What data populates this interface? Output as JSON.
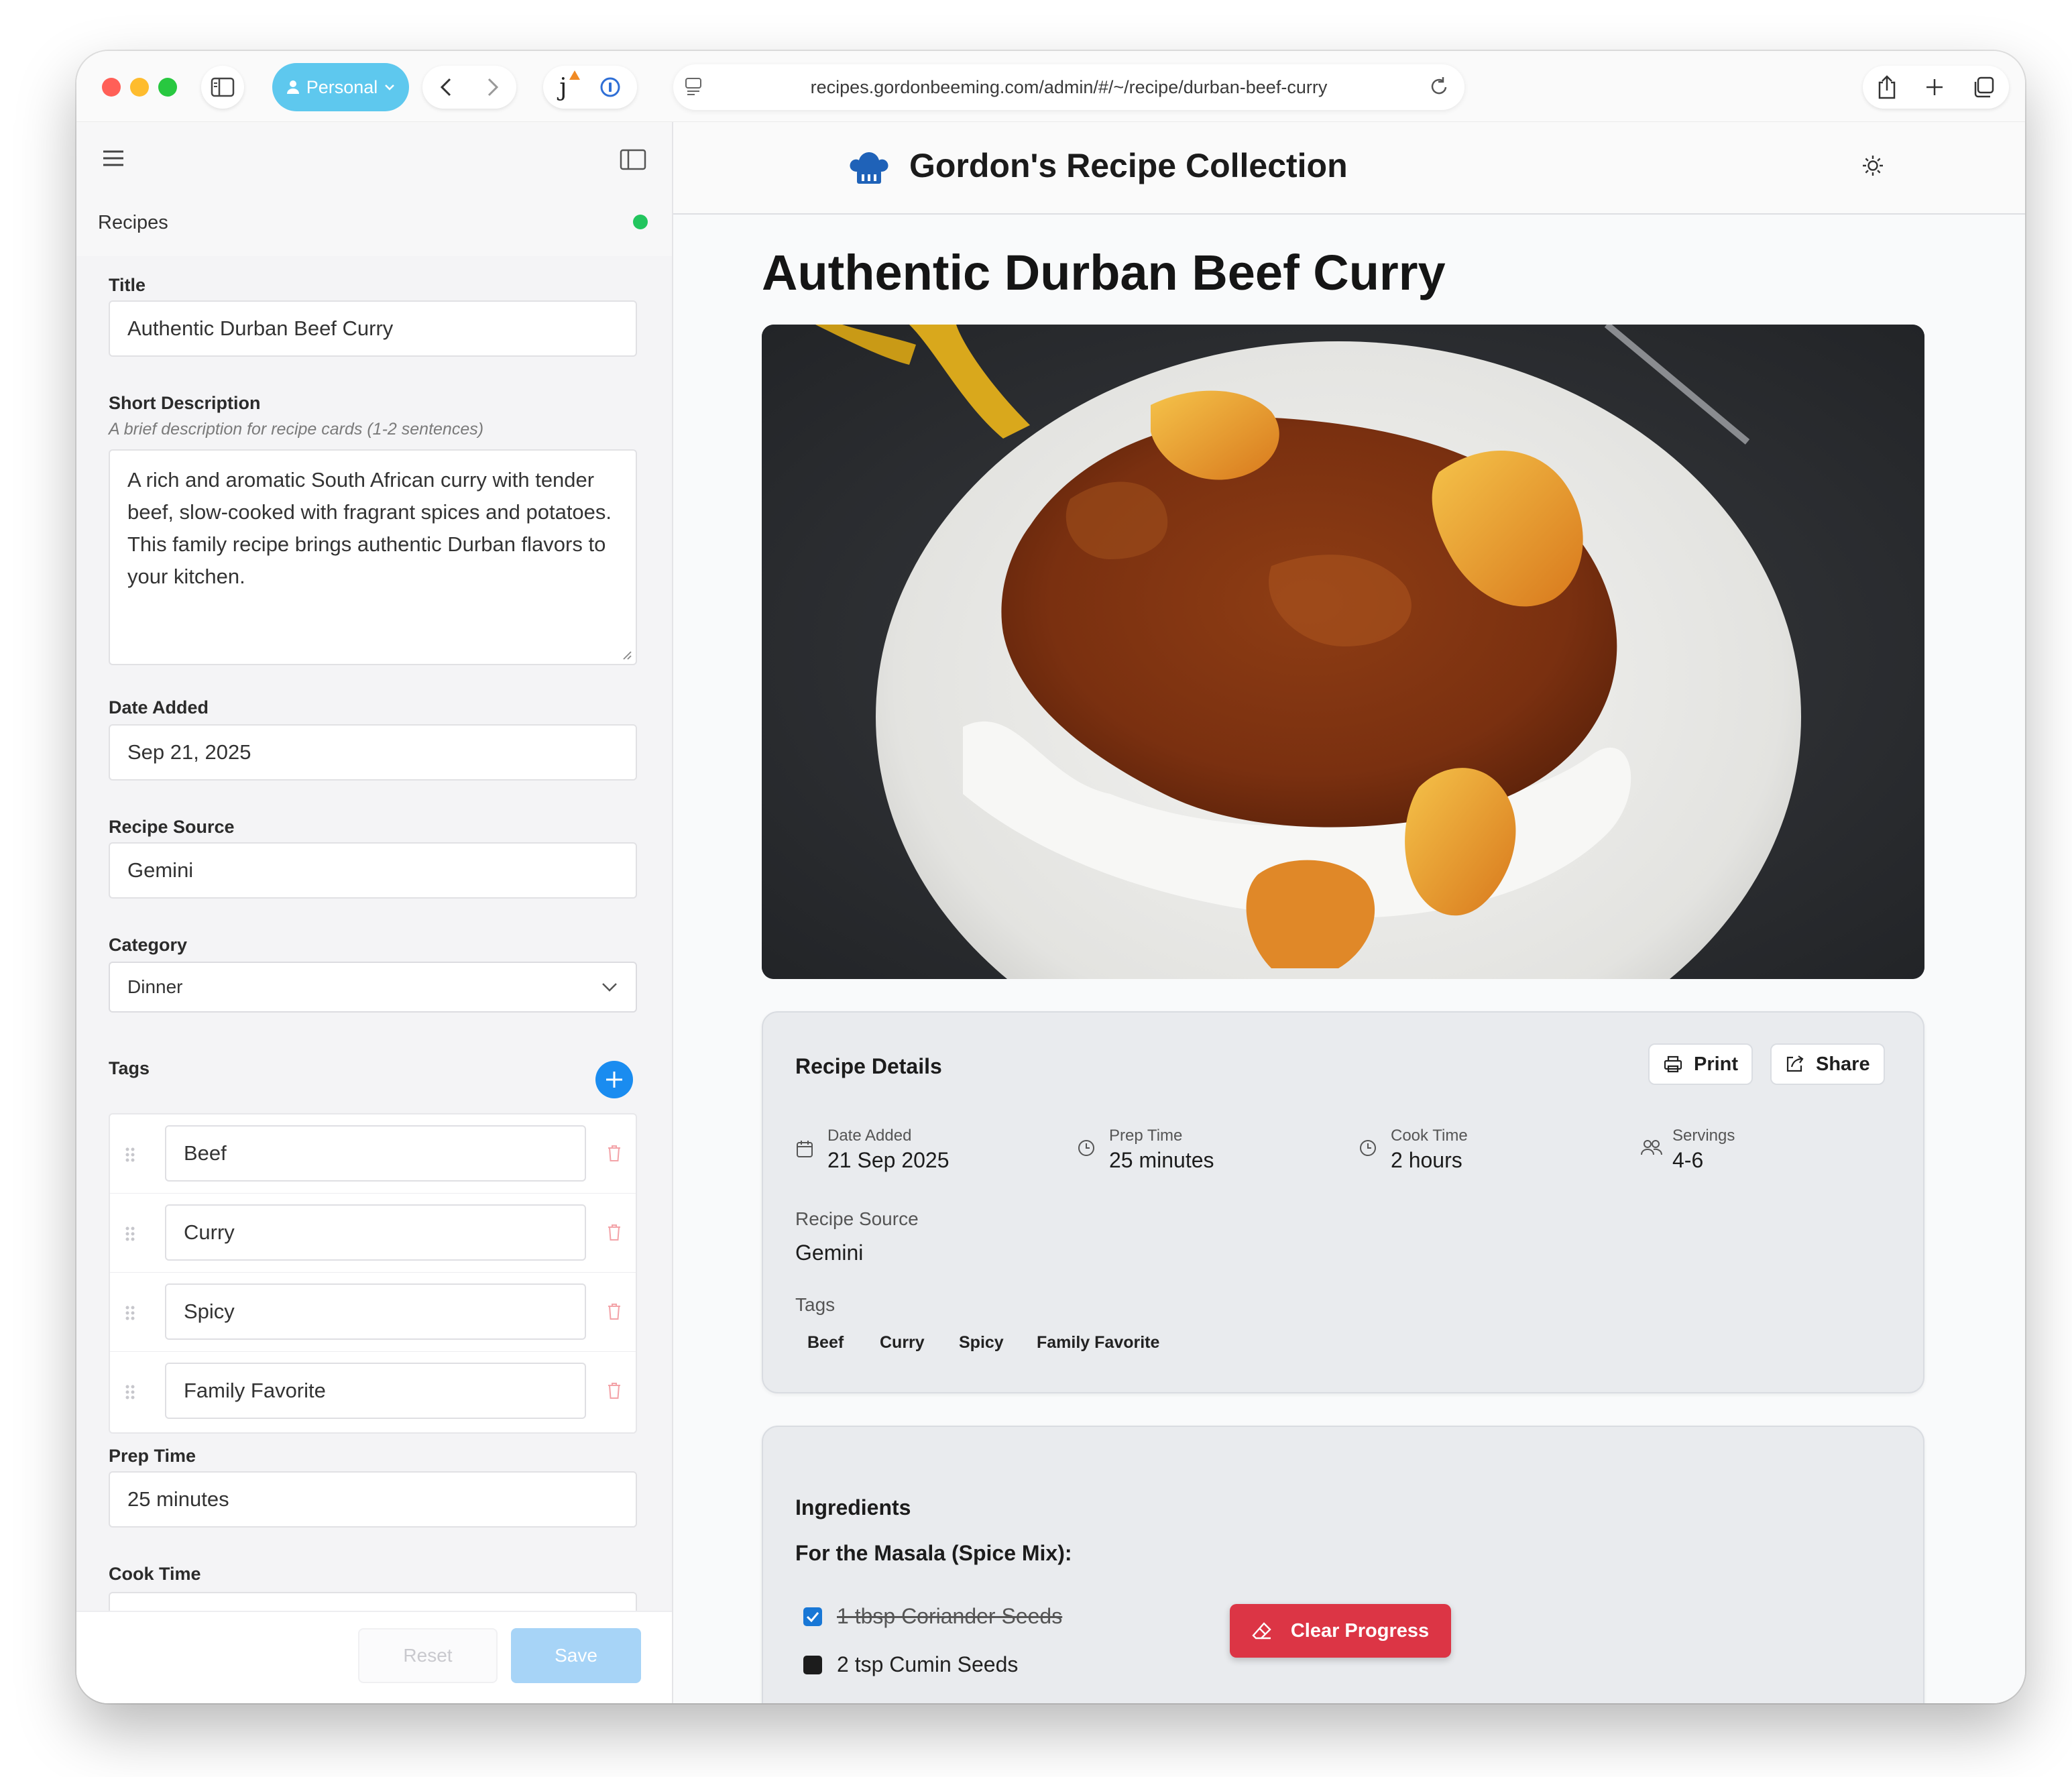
{
  "browser": {
    "profile_label": "Personal",
    "url": "recipes.gordonbeeming.com/admin/#/~/recipe/durban-beef-curry",
    "extension_letter": "j"
  },
  "admin": {
    "collection_label": "Recipes",
    "title_label": "Title",
    "title_value": "Authentic Durban Beef Curry",
    "short_desc_label": "Short Description",
    "short_desc_hint": "A brief description for recipe cards (1-2 sentences)",
    "short_desc_value": "A rich and aromatic South African curry with tender beef, slow-cooked with fragrant spices and potatoes. This family recipe brings authentic Durban flavors to your kitchen.",
    "date_label": "Date Added",
    "date_value": "Sep 21, 2025",
    "source_label": "Recipe Source",
    "source_value": "Gemini",
    "category_label": "Category",
    "category_value": "Dinner",
    "tags_label": "Tags",
    "tags": [
      "Beef",
      "Curry",
      "Spicy",
      "Family Favorite"
    ],
    "prep_label": "Prep Time",
    "prep_value": "25 minutes",
    "cook_label": "Cook Time",
    "reset_label": "Reset",
    "save_label": "Save"
  },
  "site": {
    "title": "Gordon's Recipe Collection",
    "recipe_title": "Authentic Durban Beef Curry",
    "details": {
      "heading": "Recipe Details",
      "print_label": "Print",
      "share_label": "Share",
      "date_label": "Date Added",
      "date_value": "21 Sep 2025",
      "prep_label": "Prep Time",
      "prep_value": "25 minutes",
      "cook_label": "Cook Time",
      "cook_value": "2 hours",
      "servings_label": "Servings",
      "servings_value": "4-6",
      "source_label": "Recipe Source",
      "source_value": "Gemini",
      "tags_label": "Tags",
      "tags": [
        "Beef",
        "Curry",
        "Spicy",
        "Family Favorite"
      ]
    },
    "ingredients": {
      "heading": "Ingredients",
      "subheading": "For the Masala (Spice Mix):",
      "items": [
        {
          "text": "1 tbsp Coriander Seeds",
          "checked": true
        },
        {
          "text": "2 tsp Cumin Seeds",
          "checked": false
        }
      ]
    },
    "clear_progress_label": "Clear Progress"
  },
  "colors": {
    "accent_blue": "#1a8cf0",
    "danger_red": "#dc3545",
    "status_green": "#22c55e",
    "profile_blue": "#5ec8ee"
  }
}
